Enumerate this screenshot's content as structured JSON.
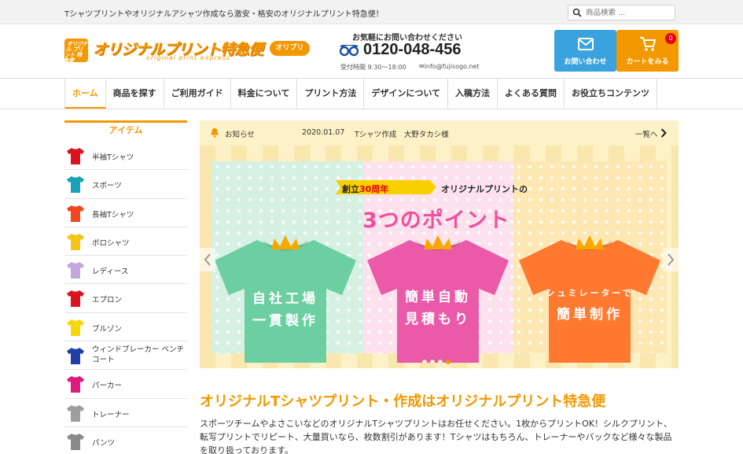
{
  "topbar": {
    "tagline": "Tシャツプリントやオリジナルアシャツ作成なら激安・格安のオリジナルプリント特急便！",
    "search_placeholder": "商品検索 ...",
    "search_icon": "search-icon"
  },
  "header": {
    "logo_badge": "オリジナル プリント 特急便",
    "logo_name": "オリジナルプリント特急便",
    "logo_sub": "original print express",
    "logo_pill": "オリプリ",
    "contact_heading": "お気軽にお問い合わせください",
    "phone": "0120-048-456",
    "hours": "受付時間 9:30〜18:00",
    "email": "info@fujisogo.net",
    "contact_button": "お問い合わせ",
    "cart_button": "カートをみる",
    "cart_count": "0"
  },
  "nav": {
    "items": [
      {
        "label": "ホーム"
      },
      {
        "label": "商品を探す"
      },
      {
        "label": "ご利用ガイド"
      },
      {
        "label": "料金について"
      },
      {
        "label": "プリント方法"
      },
      {
        "label": "デザインについて"
      },
      {
        "label": "入稿方法"
      },
      {
        "label": "よくある質問"
      },
      {
        "label": "お役立ちコンテンツ"
      }
    ]
  },
  "sidebar": {
    "title": "アイテム",
    "items": [
      {
        "label": "半袖Tシャツ",
        "color": "#d9141e"
      },
      {
        "label": "スポーツ",
        "color": "#17a2b8"
      },
      {
        "label": "長袖Tシャツ",
        "color": "#f0461e"
      },
      {
        "label": "ポロシャツ",
        "color": "#f5c518"
      },
      {
        "label": "レディース",
        "color": "#c3a6db"
      },
      {
        "label": "エプロン",
        "color": "#d9141e"
      },
      {
        "label": "ブルゾン",
        "color": "#f5d80c"
      },
      {
        "label": "ウィンドブレーカー ベンチコート",
        "color": "#1f3fa6"
      },
      {
        "label": "パーカー",
        "color": "#e0197d"
      },
      {
        "label": "トレーナー",
        "color": "#9e9e9e"
      },
      {
        "label": "パンツ",
        "color": "#8a8a8a"
      }
    ]
  },
  "notice": {
    "title": "お知らせ",
    "date": "2020.01.07",
    "text": "Tシャツ作成　大野タカシ様",
    "more": "一覧へ"
  },
  "banner": {
    "anniv_pre": "創立",
    "anniv_hl": "30周年",
    "original": "オリジナルプリントの",
    "points": "3つのポイント",
    "tee1": [
      "自社工場",
      "一貫製作"
    ],
    "tee2": [
      "簡単自動",
      "見積もり"
    ],
    "tee3_small": "シュミレーターで",
    "tee3_big": "簡単制作",
    "tee_colors": [
      "#6ccfa1",
      "#ea5aa8",
      "#ff7a30"
    ],
    "crown_color": "#f6a800"
  },
  "intro": {
    "title": "オリジナルTシャツプリント・作成はオリジナルプリント特急便",
    "body": "スポーツチームやよさこいなどのオリジナルTシャツプリントはお任せください。1枚からプリントOK！シルクプリント、転写プリントでリピート、大量買いなら、枚数割引があります！Tシャツはもちろん、トレーナーやバックなど様々な製品を取り扱っております。"
  }
}
